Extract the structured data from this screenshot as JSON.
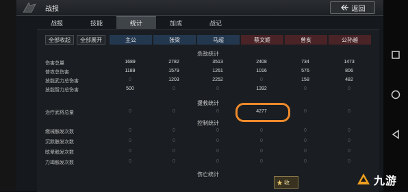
{
  "header": {
    "title": "战报",
    "back_label": "返回"
  },
  "tabs": [
    {
      "label": "战报",
      "active": false
    },
    {
      "label": "技能",
      "active": false
    },
    {
      "label": "统计",
      "active": true
    },
    {
      "label": "加成",
      "active": false
    },
    {
      "label": "战记",
      "active": false
    }
  ],
  "controls": {
    "collapse_all": "全部收起",
    "expand_all": "全部展开"
  },
  "players": [
    {
      "name": "主公",
      "side": "ally"
    },
    {
      "name": "张梁",
      "side": "ally"
    },
    {
      "name": "马超",
      "side": "ally"
    },
    {
      "name": "蔡文姬",
      "side": "enemy"
    },
    {
      "name": "曾亥",
      "side": "enemy"
    },
    {
      "name": "公孙越",
      "side": "enemy"
    }
  ],
  "sections": {
    "kill": "杀敌统计",
    "rescue": "援救统计",
    "control": "控制统计",
    "death": "伤亡统计"
  },
  "kill_rows": [
    {
      "label": "伤害总量",
      "values": [
        "1689",
        "2782",
        "3513",
        "2408",
        "734",
        "1473"
      ]
    },
    {
      "label": "普攻总伤害",
      "values": [
        "1189",
        "1579",
        "1261",
        "1016",
        "576",
        "806"
      ]
    },
    {
      "label": "技能武力总伤害",
      "values": [
        "0",
        "1203",
        "2252",
        "0",
        "158",
        "482"
      ]
    },
    {
      "label": "技能智力总伤害",
      "values": [
        "500",
        "0",
        "0",
        "1392",
        "0",
        "0"
      ]
    }
  ],
  "rescue_rows": [
    {
      "label": "治疗武将总量",
      "values": [
        "0",
        "0",
        "0",
        "4277",
        "0",
        "0"
      ]
    }
  ],
  "control_rows": [
    {
      "label": "缴械触发次数",
      "values": [
        "0",
        "0",
        "0",
        "0",
        "0",
        "0"
      ]
    },
    {
      "label": "沉默触发次数",
      "values": [
        "0",
        "0",
        "0",
        "0",
        "0",
        "0"
      ]
    },
    {
      "label": "眩晕触发次数",
      "values": [
        "0",
        "0",
        "0",
        "0",
        "0",
        "0"
      ]
    },
    {
      "label": "力竭触发次数",
      "values": [
        "0",
        "0",
        "0",
        "0",
        "0",
        "0"
      ]
    }
  ],
  "bottom_button": {
    "label": "收"
  },
  "watermark": {
    "text": "九游"
  },
  "colors": {
    "ally_header": "#23384f",
    "enemy_header": "#4a2326",
    "highlight": "#f08a2b"
  },
  "icons": {
    "back": "back-arrow-icon",
    "android_square": "square-icon",
    "android_home": "circle-icon",
    "android_back": "triangle-back-icon"
  }
}
